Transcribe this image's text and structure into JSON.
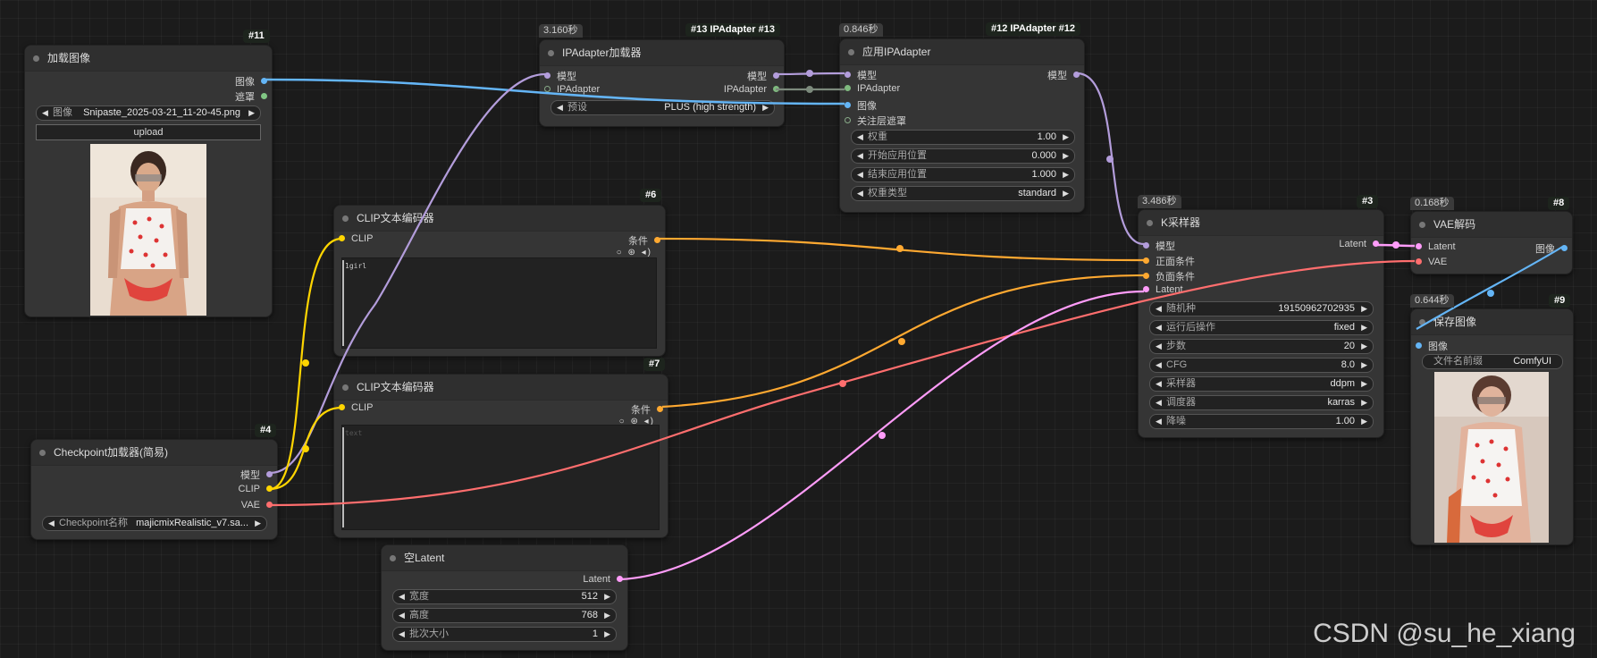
{
  "nodes": {
    "load_image": {
      "id": "#11",
      "title": "加载图像",
      "outputs": [
        "图像",
        "遮罩"
      ],
      "image_widget": {
        "label": "图像",
        "value": "Snipaste_2025-03-21_11-20-45.png"
      },
      "upload_label": "upload"
    },
    "ipa_loader": {
      "id": "#13 IPAdapter  #13",
      "time": "3.160秒",
      "title": "IPAdapter加载器",
      "inputs": [
        "模型",
        "IPAdapter"
      ],
      "outputs": [
        "模型",
        "IPAdapter"
      ],
      "preset": {
        "label": "预设",
        "value": "PLUS (high strength)"
      }
    },
    "apply_ipa": {
      "id": "#12 IPAdapter  #12",
      "time": "0.846秒",
      "title": "应用IPAdapter",
      "inputs": [
        "模型",
        "IPAdapter",
        "图像",
        "关注层遮罩"
      ],
      "outputs": [
        "模型"
      ],
      "widgets": [
        {
          "label": "权重",
          "value": "1.00"
        },
        {
          "label": "开始应用位置",
          "value": "0.000"
        },
        {
          "label": "结束应用位置",
          "value": "1.000"
        },
        {
          "label": "权重类型",
          "value": "standard"
        }
      ]
    },
    "clip_pos": {
      "id": "#6",
      "title": "CLIP文本编码器",
      "inputs": [
        "CLIP"
      ],
      "outputs": [
        "条件"
      ],
      "text": "1girl",
      "tools": "○ ⊛ ◂)"
    },
    "clip_neg": {
      "id": "#7",
      "title": "CLIP文本编码器",
      "inputs": [
        "CLIP"
      ],
      "outputs": [
        "条件"
      ],
      "placeholder": "text",
      "tools": "○ ⊛ ◂)"
    },
    "checkpoint": {
      "id": "#4",
      "title": "Checkpoint加载器(简易)",
      "outputs": [
        "模型",
        "CLIP",
        "VAE"
      ],
      "ckpt": {
        "label": "Checkpoint名称",
        "value": "majicmixRealistic_v7.sa..."
      }
    },
    "latent": {
      "title": "空Latent",
      "outputs": [
        "Latent"
      ],
      "widgets": [
        {
          "label": "宽度",
          "value": "512"
        },
        {
          "label": "高度",
          "value": "768"
        },
        {
          "label": "批次大小",
          "value": "1"
        }
      ]
    },
    "ksampler": {
      "id": "#3",
      "time": "3.486秒",
      "title": "K采样器",
      "inputs": [
        "模型",
        "正面条件",
        "负面条件",
        "Latent"
      ],
      "outputs": [
        "Latent"
      ],
      "widgets": [
        {
          "label": "随机种",
          "value": "19150962702935"
        },
        {
          "label": "运行后操作",
          "value": "fixed"
        },
        {
          "label": "步数",
          "value": "20"
        },
        {
          "label": "CFG",
          "value": "8.0"
        },
        {
          "label": "采样器",
          "value": "ddpm"
        },
        {
          "label": "调度器",
          "value": "karras"
        },
        {
          "label": "降噪",
          "value": "1.00"
        }
      ]
    },
    "vae_decode": {
      "id": "#8",
      "time": "0.168秒",
      "title": "VAE解码",
      "inputs": [
        "Latent",
        "VAE"
      ],
      "outputs": [
        "图像"
      ]
    },
    "save_image": {
      "id": "#9",
      "time": "0.644秒",
      "title": "保存图像",
      "inputs": [
        "图像"
      ],
      "prefix": {
        "label": "文件名前缀",
        "value": "ComfyUI"
      }
    }
  },
  "watermark": "CSDN @su_he_xiang",
  "colors": {
    "model": "#b39ddb",
    "clip": "#ffd500",
    "vae": "#ff6e6e",
    "conditioning": "#ffa931",
    "latent": "#ff9cf9",
    "image": "#64b5f6",
    "ipadapter": "#7fba7f",
    "mask": "#81c784"
  }
}
